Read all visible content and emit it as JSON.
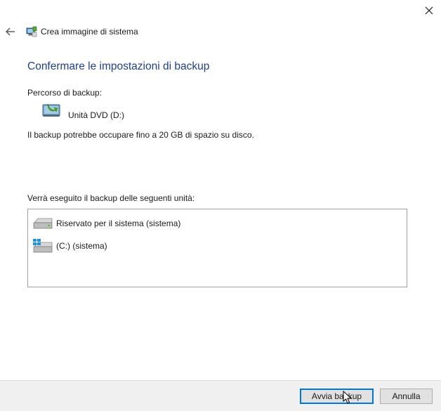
{
  "window": {
    "title": "Crea immagine di sistema",
    "app_icon": "backup-app-icon",
    "back_icon": "back-arrow-icon",
    "close_icon": "close-icon"
  },
  "page": {
    "title": "Confermare le impostazioni di backup",
    "backup_path_label": "Percorso di backup:",
    "destination": {
      "icon": "dvd-drive-icon",
      "label": "Unità DVD (D:)"
    },
    "space_note": "Il backup potrebbe occupare fino a 20 GB di spazio su disco.",
    "drives_label": "Verrà eseguito il backup delle seguenti unità:",
    "drives": [
      {
        "icon": "hard-drive-icon",
        "label": "Riservato per il sistema (sistema)"
      },
      {
        "icon": "windows-drive-icon",
        "label": "(C:) (sistema)"
      }
    ]
  },
  "footer": {
    "start_label": "Avvia backup",
    "cancel_label": "Annulla"
  },
  "colors": {
    "title_blue": "#1e3f8a",
    "accent": "#0078d7",
    "footer_bg": "#f0f0f0"
  }
}
